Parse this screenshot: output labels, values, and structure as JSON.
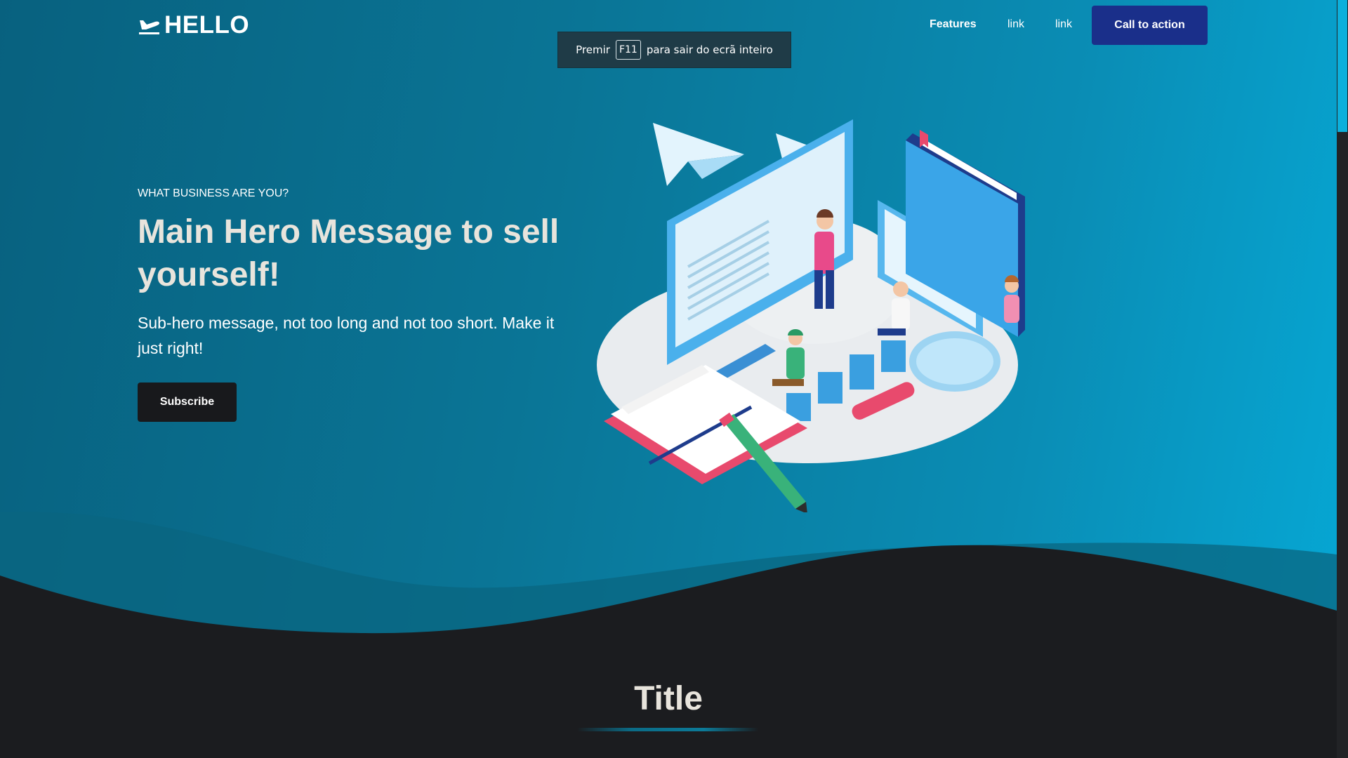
{
  "brand": {
    "name": "HELLO",
    "icon": "airplane-departure-icon"
  },
  "nav": {
    "features": "Features",
    "link1": "link",
    "link2": "link",
    "cta": "Call to action"
  },
  "toast": {
    "prefix": "Premir",
    "key": "F11",
    "suffix": "para sair do ecrã inteiro"
  },
  "hero": {
    "eyebrow": "WHAT BUSINESS ARE YOU?",
    "headline": "Main Hero Message to sell yourself!",
    "subhead": "Sub-hero message, not too long and not too short. Make it just right!",
    "button": "Subscribe"
  },
  "section": {
    "title": "Title"
  },
  "colors": {
    "hero_start": "#08617f",
    "hero_end": "#06a8d5",
    "cta_bg": "#1a2f8a",
    "dark_bg": "#1b1c1f",
    "subscribe_bg": "#18191c"
  }
}
